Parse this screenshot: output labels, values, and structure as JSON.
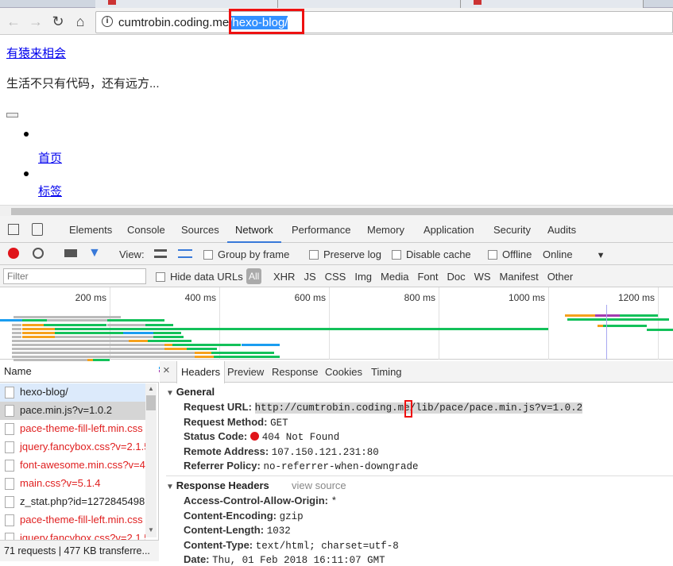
{
  "browser": {
    "url_host": "cumtrobin.coding.me",
    "url_path": "/hexo-blog/"
  },
  "page": {
    "site_title": "有猿来相会",
    "subtitle": "生活不只有代码，还有远方...",
    "nav": [
      "首页",
      "标签"
    ]
  },
  "devtools": {
    "tabs": [
      "Elements",
      "Console",
      "Sources",
      "Network",
      "Performance",
      "Memory",
      "Application",
      "Security",
      "Audits"
    ],
    "active_tab": "Network",
    "toolbar": {
      "view": "View:",
      "group_by_frame": "Group by frame",
      "preserve_log": "Preserve log",
      "disable_cache": "Disable cache",
      "offline": "Offline",
      "throttle": "Online"
    },
    "filter": {
      "placeholder": "Filter",
      "hide_data_urls": "Hide data URLs",
      "types": [
        "All",
        "XHR",
        "JS",
        "CSS",
        "Img",
        "Media",
        "Font",
        "Doc",
        "WS",
        "Manifest",
        "Other"
      ]
    },
    "timeline": {
      "ticks": [
        "200 ms",
        "400 ms",
        "600 ms",
        "800 ms",
        "1000 ms",
        "1200 ms"
      ]
    },
    "name_header": "Name",
    "requests": [
      {
        "name": "hexo-blog/",
        "error": false
      },
      {
        "name": "pace.min.js?v=1.0.2",
        "error": false
      },
      {
        "name": "pace-theme-fill-left.min.css",
        "error": true
      },
      {
        "name": "jquery.fancybox.css?v=2.1.5",
        "error": true
      },
      {
        "name": "font-awesome.min.css?v=4",
        "error": true
      },
      {
        "name": "main.css?v=5.1.4",
        "error": true
      },
      {
        "name": "z_stat.php?id=1272845498",
        "error": false
      },
      {
        "name": "pace-theme-fill-left.min.css",
        "error": true
      },
      {
        "name": "jquery.fancybox.css?v=2.1.5",
        "error": true
      }
    ],
    "status": "71 requests | 477 KB transferre...",
    "detail_tabs": [
      "Headers",
      "Preview",
      "Response",
      "Cookies",
      "Timing"
    ],
    "general": {
      "title": "General",
      "rows": [
        {
          "k": "Request URL:",
          "v": "http://cumtrobin.coding.me/lib/pace/pace.min.js?v=1.0.2"
        },
        {
          "k": "Request Method:",
          "v": "GET"
        },
        {
          "k": "Status Code:",
          "v": "404 Not Found"
        },
        {
          "k": "Remote Address:",
          "v": "107.150.121.231:80"
        },
        {
          "k": "Referrer Policy:",
          "v": "no-referrer-when-downgrade"
        }
      ]
    },
    "response_headers": {
      "title": "Response Headers",
      "view_source": "view source",
      "rows": [
        {
          "k": "Access-Control-Allow-Origin:",
          "v": "*"
        },
        {
          "k": "Content-Encoding:",
          "v": "gzip"
        },
        {
          "k": "Content-Length:",
          "v": "1032"
        },
        {
          "k": "Content-Type:",
          "v": "text/html; charset=utf-8"
        },
        {
          "k": "Date:",
          "v": "Thu, 01 Feb 2018 16:11:07 GMT"
        }
      ]
    }
  },
  "colors": {
    "accent": "#3879d9",
    "error": "#e02020",
    "highlight": "#e11111",
    "selection": "#3390ff"
  }
}
